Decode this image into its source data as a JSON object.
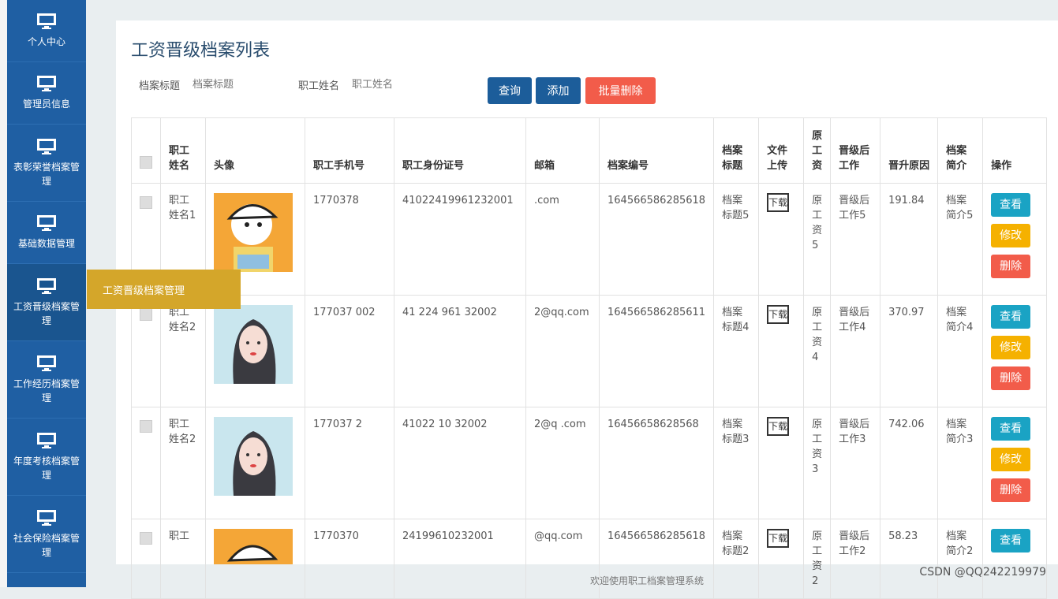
{
  "sidebar": {
    "items": [
      {
        "label": "个人中心"
      },
      {
        "label": "管理员信息"
      },
      {
        "label": "表彰荣誉档案管理"
      },
      {
        "label": "基础数据管理"
      },
      {
        "label": "工资晋级档案管理"
      },
      {
        "label": "工作经历档案管理"
      },
      {
        "label": "年度考核档案管理"
      },
      {
        "label": "社会保险档案管理"
      }
    ],
    "icon": "monitor-icon",
    "submenu_label": "工资晋级档案管理"
  },
  "page": {
    "title": "工资晋级档案列表"
  },
  "search": {
    "archive_title_label": "档案标题",
    "archive_title_placeholder": "档案标题",
    "employee_name_label": "职工姓名",
    "employee_name_placeholder": "职工姓名"
  },
  "buttons": {
    "query": "查询",
    "add": "添加",
    "batch_delete": "批量删除"
  },
  "table": {
    "headers": [
      "职工姓名",
      "头像",
      "职工手机号",
      "职工身份证号",
      "邮箱",
      "档案编号",
      "档案标题",
      "文件上传",
      "原工资",
      "晋级后工作",
      "晋升原因",
      "档案简介",
      "操作"
    ],
    "rows": [
      {
        "name": "职工姓名1",
        "avatar": "cartoon",
        "phone": "1770378",
        "idcard": "41022419961232001",
        "email": ".com",
        "archive_no": "164566586285618",
        "title": "档案标题5",
        "file": "下载",
        "salary": "原工资5",
        "after": "晋级后工作5",
        "reason": "191.84",
        "intro": "档案简介5"
      },
      {
        "name": "职工姓名2",
        "avatar": "girl",
        "phone": "177037 002",
        "idcard": "41 224 961 32002",
        "email": "2@qq.com",
        "archive_no": "164566586285611",
        "title": "档案标题4",
        "file": "下载",
        "salary": "原工资4",
        "after": "晋级后工作4",
        "reason": "370.97",
        "intro": "档案简介4"
      },
      {
        "name": "职工姓名2",
        "avatar": "girl",
        "phone": "177037 2",
        "idcard": "41022 10 32002",
        "email": "2@q .com",
        "archive_no": "16456658628568",
        "title": "档案标题3",
        "file": "下载",
        "salary": "原工资3",
        "after": "晋级后工作3",
        "reason": "742.06",
        "intro": "档案简介3"
      },
      {
        "name": "职工",
        "avatar": "cartoon",
        "phone": "1770370",
        "idcard": "24199610232001",
        "email": "@qq.com",
        "archive_no": "164566586285618",
        "title": "档案标题2",
        "file": "下载",
        "salary": "原工资2",
        "after": "晋级后工作2",
        "reason": "58.23",
        "intro": "档案简介2"
      }
    ],
    "actions": {
      "view": "查看",
      "edit": "修改",
      "delete": "删除"
    }
  },
  "footer": {
    "text": "欢迎使用职工档案管理系统"
  },
  "watermark": {
    "text": "CSDN @QQ242219979"
  },
  "colors": {
    "sidebar": "#1f5fa3",
    "submenu": "#d4a62a",
    "primary": "#1c5d9a",
    "danger": "#f25c4a",
    "info": "#1aa3c4",
    "warning": "#f5b100"
  }
}
